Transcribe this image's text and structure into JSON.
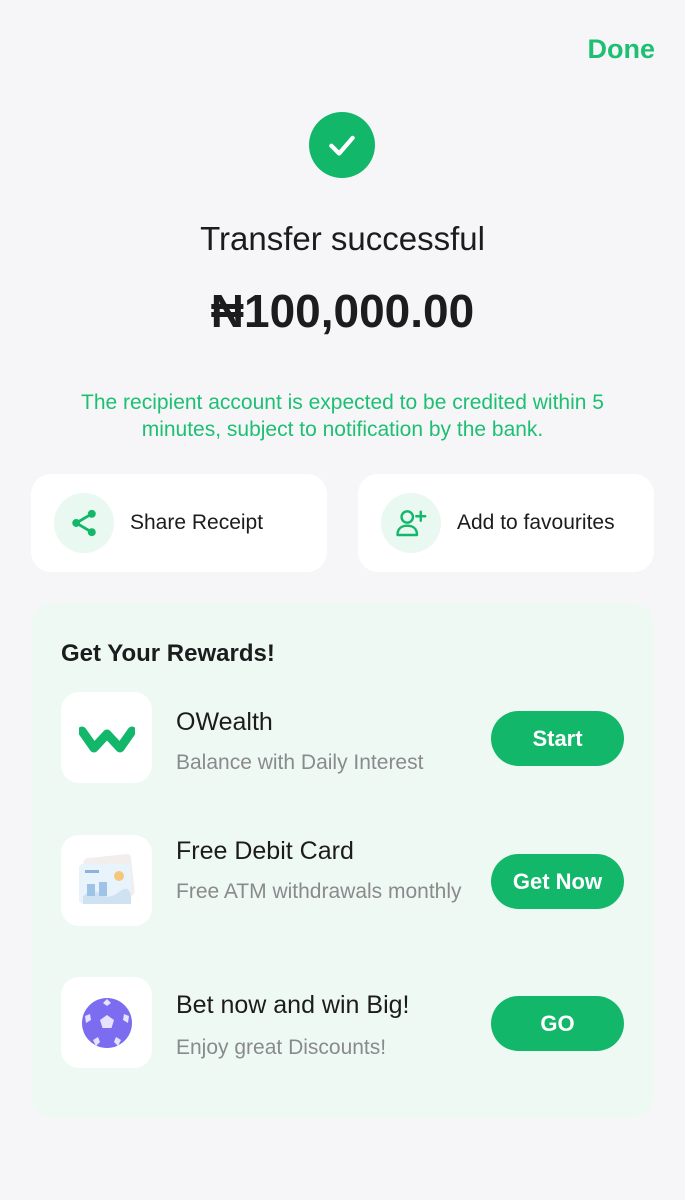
{
  "header": {
    "done_label": "Done"
  },
  "status": {
    "title": "Transfer successful",
    "amount": "₦100,000.00",
    "notice": "The recipient account is expected to be credited within 5 minutes, subject to notification by the bank."
  },
  "actions": [
    {
      "label": "Share Receipt",
      "icon": "share-icon"
    },
    {
      "label": "Add to favourites",
      "icon": "add-user-icon"
    }
  ],
  "rewards": {
    "title": "Get Your Rewards!",
    "items": [
      {
        "name": "OWealth",
        "description": "Balance with Daily Interest",
        "button": "Start",
        "icon": "owealth-logo"
      },
      {
        "name": "Free Debit Card",
        "description": "Free ATM withdrawals monthly",
        "button": "Get Now",
        "icon": "debit-card-icon"
      },
      {
        "name": "Bet now and win Big!",
        "description": "Enjoy great Discounts!",
        "button": "GO",
        "icon": "football-icon"
      }
    ]
  },
  "colors": {
    "accent": "#12b76a",
    "accent_text": "#1dbf73",
    "background": "#f6f6f8",
    "rewards_bg": "#eff9f3"
  }
}
